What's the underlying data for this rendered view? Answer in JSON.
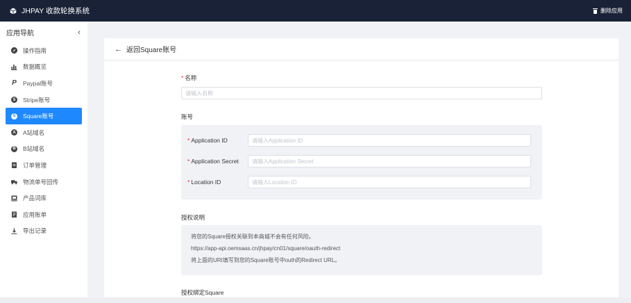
{
  "app": {
    "title": "JHPAY 收款轮换系统",
    "delete_label": "删除应用"
  },
  "sidebar": {
    "title": "应用导航",
    "collapse_icon": "chevron-left",
    "items": [
      {
        "label": "操作指南",
        "icon": "compass-icon"
      },
      {
        "label": "数据概览",
        "icon": "bar-chart-icon"
      },
      {
        "label": "Paypal账号",
        "icon": "paypal-icon"
      },
      {
        "label": "Stripe账号",
        "icon": "stripe-icon"
      },
      {
        "label": "Square账号",
        "icon": "square-icon",
        "active": true
      },
      {
        "label": "A站域名",
        "icon": "letter-a-icon"
      },
      {
        "label": "B站域名",
        "icon": "letter-b-icon"
      },
      {
        "label": "订单管理",
        "icon": "clipboard-icon"
      },
      {
        "label": "物流单号回传",
        "icon": "truck-icon"
      },
      {
        "label": "产品词库",
        "icon": "book-icon"
      },
      {
        "label": "应用账单",
        "icon": "bill-icon"
      },
      {
        "label": "导出记录",
        "icon": "download-icon"
      }
    ]
  },
  "main": {
    "back_label": "返回Square账号",
    "name": {
      "label": "名称",
      "placeholder": "请输入名称",
      "value": ""
    },
    "account": {
      "label": "账号",
      "fields": [
        {
          "label": "Application ID",
          "placeholder": "请输入Application ID",
          "value": ""
        },
        {
          "label": "Application Secret",
          "placeholder": "请输入Application Secret",
          "value": ""
        },
        {
          "label": "Location ID",
          "placeholder": "请输入Location ID",
          "value": ""
        }
      ]
    },
    "auth": {
      "label": "授权说明",
      "lines": [
        "将您的Square授权关联到本商城不会有任何风险。",
        "https://app-api.oemsaas.cn/jhpay/cn01/square/oauth-redirect",
        "将上面的URI填写到您的Square账号中outh的Redirect URL。"
      ]
    },
    "bind_label": "授权绑定Square"
  },
  "colors": {
    "topbar": "#1a2237",
    "accent": "#1e88ff",
    "required": "#f5222d"
  }
}
